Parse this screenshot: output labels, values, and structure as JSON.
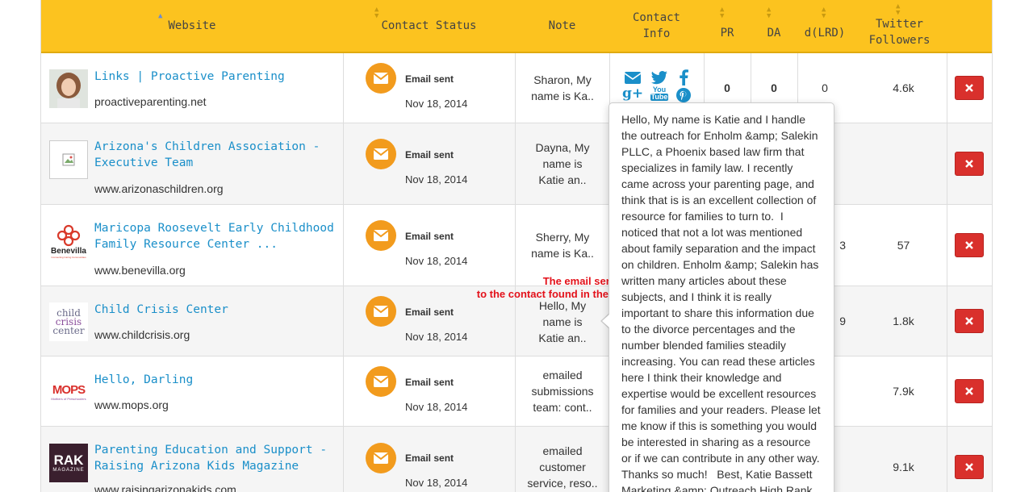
{
  "headers": {
    "website": "Website",
    "contact_status": "Contact Status",
    "note": "Note",
    "contact_info": "Contact\nInfo",
    "pr": "PR",
    "da": "DA",
    "dlrd": "d(LRD)",
    "twitter": "Twitter\nFollowers"
  },
  "rows": [
    {
      "title": "Links | Proactive Parenting",
      "url": "proactiveparenting.net",
      "status": "Email sent",
      "date": "Nov 18, 2014",
      "note": "Sharon,   My name is Ka..",
      "pr": "0",
      "da": "0",
      "lrd": "0",
      "twitter": "4.6k",
      "thumb": "person-photo"
    },
    {
      "title": "Arizona's Children Association - Executive Team",
      "url": "www.arizonaschildren.org",
      "status": "Email sent",
      "date": "Nov 18, 2014",
      "note": "Dayna, My name is Katie an..",
      "pr": "",
      "da": "",
      "lrd": "",
      "twitter": "",
      "thumb": "broken-image"
    },
    {
      "title": "Maricopa Roosevelt Early Childhood Family Resource Center ...",
      "url": "www.benevilla.org",
      "status": "Email sent",
      "date": "Nov 18, 2014",
      "note": "Sherry,   My name is Ka..",
      "pr": "",
      "da": "",
      "lrd": "3",
      "twitter": "57",
      "thumb": "benevilla-logo"
    },
    {
      "title": "Child Crisis Center",
      "url": "www.childcrisis.org",
      "status": "Email sent",
      "date": "Nov 18, 2014",
      "note": "Hello, My name is Katie an..",
      "pr": "",
      "da": "",
      "lrd": "9",
      "twitter": "1.8k",
      "thumb": "child-crisis-logo"
    },
    {
      "title": "Hello, Darling",
      "url": "www.mops.org",
      "status": "Email sent",
      "date": "Nov 18, 2014",
      "note": "emailed submissions team: cont..",
      "pr": "",
      "da": "",
      "lrd": "",
      "twitter": "7.9k",
      "thumb": "mops-logo"
    },
    {
      "title": "Parenting Education and Support - Raising Arizona Kids Magazine",
      "url": "www.raisingarizonakids.com",
      "status": "Email sent",
      "date": "Nov 18, 2014",
      "note": "emailed customer service, reso..",
      "pr": "",
      "da": "",
      "lrd": "",
      "twitter": "9.1k",
      "thumb": "rak-logo"
    }
  ],
  "logos": {
    "benevilla": "Benevilla",
    "benevilla_sub": "Connecting Caring Communities",
    "child_crisis": [
      "child",
      "crisis",
      "center"
    ],
    "mops": "MOPS",
    "mops_sub": "Mothers of Preschoolers",
    "rak": [
      "RAK",
      "MAGAZINE"
    ]
  },
  "contact_icons": [
    "email-icon",
    "twitter-icon",
    "facebook-icon",
    "google-plus-icon",
    "youtube-icon",
    "pinterest-icon"
  ],
  "icon_glyphs": {
    "google_plus": "g+",
    "youtube": [
      "You",
      "Tube"
    ]
  },
  "popover": {
    "text": "Hello, My name is Katie and I handle the outreach for Enholm &amp; Salekin PLLC, a Phoenix based law firm that specializes in family law. I recently came across your parenting page, and think that is is an excellent collection of resource for families to turn to.  I noticed that not a lot was mentioned about family separation and the impact on children. Enholm &amp; Salekin has written many articles about these subjects, and I think it is really important to share this information due to the divorce percentages and the number blended families steadily increasing. You can read these articles here I think their knowledge and expertise would be excellent resources for families and your readers. Please let me know if this is something you would be interested in sharing as a resource or if we can contribute in any other way. Thanks so much!   Best, Katie Bassett Marketing &amp; Outreach High Rank"
  },
  "annotation": {
    "line1": "The email sent",
    "line2": "to the contact found in the site"
  },
  "colors": {
    "header": "#fcc31f",
    "link": "#1a8fc9",
    "status": "#f29b1d",
    "delete": "#d9302c",
    "annotation": "#e3111a"
  }
}
